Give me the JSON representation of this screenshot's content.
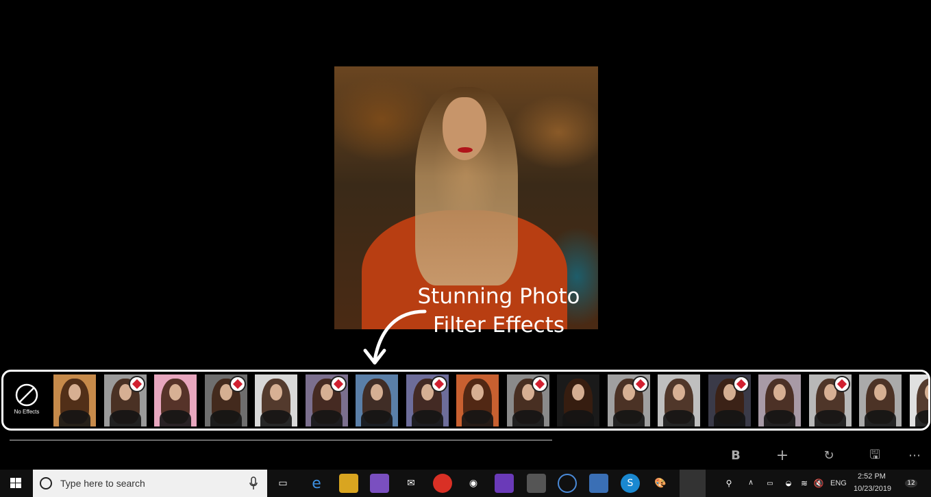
{
  "caption": {
    "line1": "Stunning Photo",
    "line2": "Filter Effects"
  },
  "filters": {
    "no_effects_label": "No Effects",
    "thumbs": [
      {
        "tint": "#c68a4a",
        "premium": false
      },
      {
        "tint": "#9a9a9a",
        "premium": true
      },
      {
        "tint": "#e7a6be",
        "premium": false
      },
      {
        "tint": "#6e6e6e",
        "premium": true
      },
      {
        "tint": "#d8d8d8",
        "premium": false
      },
      {
        "tint": "#7b6f8e",
        "premium": true
      },
      {
        "tint": "#5a7fa8",
        "premium": false
      },
      {
        "tint": "#6d6d9a",
        "premium": true
      },
      {
        "tint": "#c86030",
        "premium": false
      },
      {
        "tint": "#8a8a8a",
        "premium": true
      },
      {
        "tint": "#1a1a1a",
        "premium": false
      },
      {
        "tint": "#a0a0a0",
        "premium": true
      },
      {
        "tint": "#bfbfbf",
        "premium": false
      },
      {
        "tint": "#3a3a48",
        "premium": true
      },
      {
        "tint": "#a89aa6",
        "premium": false
      },
      {
        "tint": "#b8b8b8",
        "premium": true
      },
      {
        "tint": "#aaaaaa",
        "premium": false
      },
      {
        "tint": "#e0e0e0",
        "premium": false
      }
    ]
  },
  "app_bar": {
    "bold_label": "B",
    "add_label": "+",
    "rotate_label": "↻",
    "save_label": "🖫",
    "more_label": "⋯"
  },
  "taskbar": {
    "search_placeholder": "Type here to search",
    "language": "ENG",
    "time": "2:52 PM",
    "date": "10/23/2019",
    "notification_count": "12"
  }
}
